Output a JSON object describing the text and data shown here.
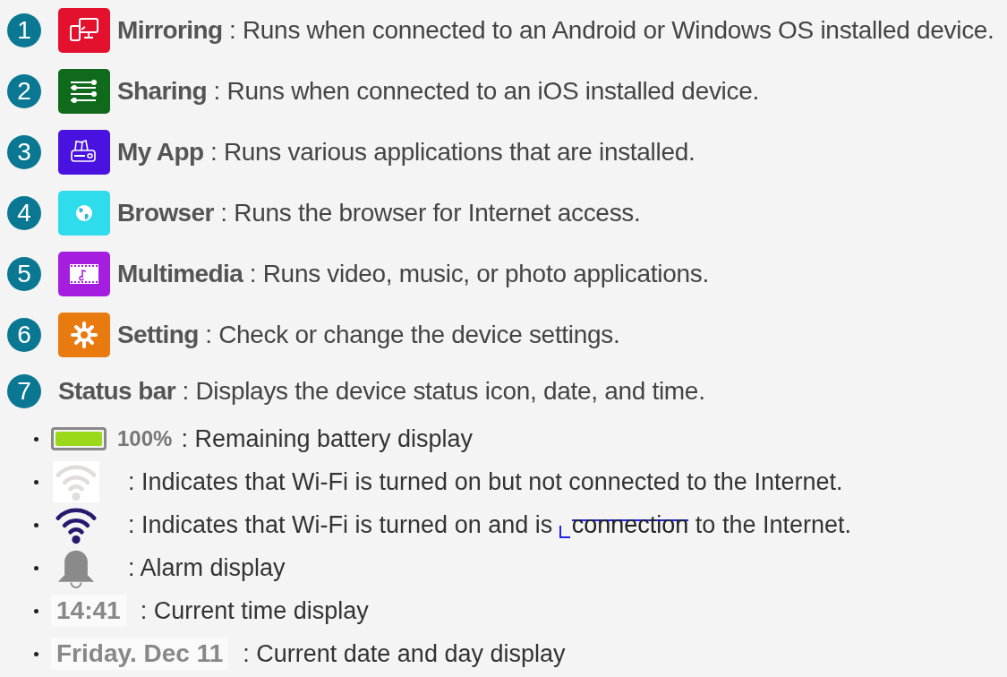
{
  "apps": [
    {
      "number": "1",
      "kind": "mirroring",
      "color": "#e3112e",
      "title": "Mirroring",
      "description": ": Runs when connected to an Android or Windows OS installed device."
    },
    {
      "number": "2",
      "kind": "sharing",
      "color": "#0f6a1c",
      "title": "Sharing",
      "description": ": Runs when connected to an iOS installed device."
    },
    {
      "number": "3",
      "kind": "myapp",
      "color": "#4a12e0",
      "title": "My App",
      "description": ": Runs various applications that are installed."
    },
    {
      "number": "4",
      "kind": "browser",
      "color": "#2fdcec",
      "title": "Browser",
      "description": ": Runs the browser for Internet access."
    },
    {
      "number": "5",
      "kind": "multimedia",
      "color": "#a51ee0",
      "title": "Multimedia",
      "description": ": Runs video, music, or photo applications."
    },
    {
      "number": "6",
      "kind": "setting",
      "color": "#e87a10",
      "title": "Setting",
      "description": ": Check or change the device settings."
    }
  ],
  "status_bar": {
    "number": "7",
    "title": "Status bar",
    "description": ": Displays the device status icon, date, and time.",
    "items": [
      {
        "kind": "battery",
        "level": 1,
        "label": "100%",
        "description": ": Remaining battery display"
      },
      {
        "kind": "wifi",
        "connected": false,
        "description": ": Indicates that Wi-Fi is turned on but not connected to the Internet."
      },
      {
        "kind": "wifi",
        "connected": true,
        "description_parts": [
          {
            "text": ": Indicates that Wi-Fi is turned on and is",
            "struck": false
          },
          {
            "text": "connection",
            "struck": true
          },
          {
            "text": "to the Internet.",
            "struck": false
          }
        ]
      },
      {
        "kind": "alarm",
        "description": ": Alarm display"
      },
      {
        "kind": "time",
        "label": "14:41",
        "description": ": Current time display"
      },
      {
        "kind": "date",
        "label": "Friday. Dec 11",
        "description": ": Current date and day display"
      }
    ]
  }
}
